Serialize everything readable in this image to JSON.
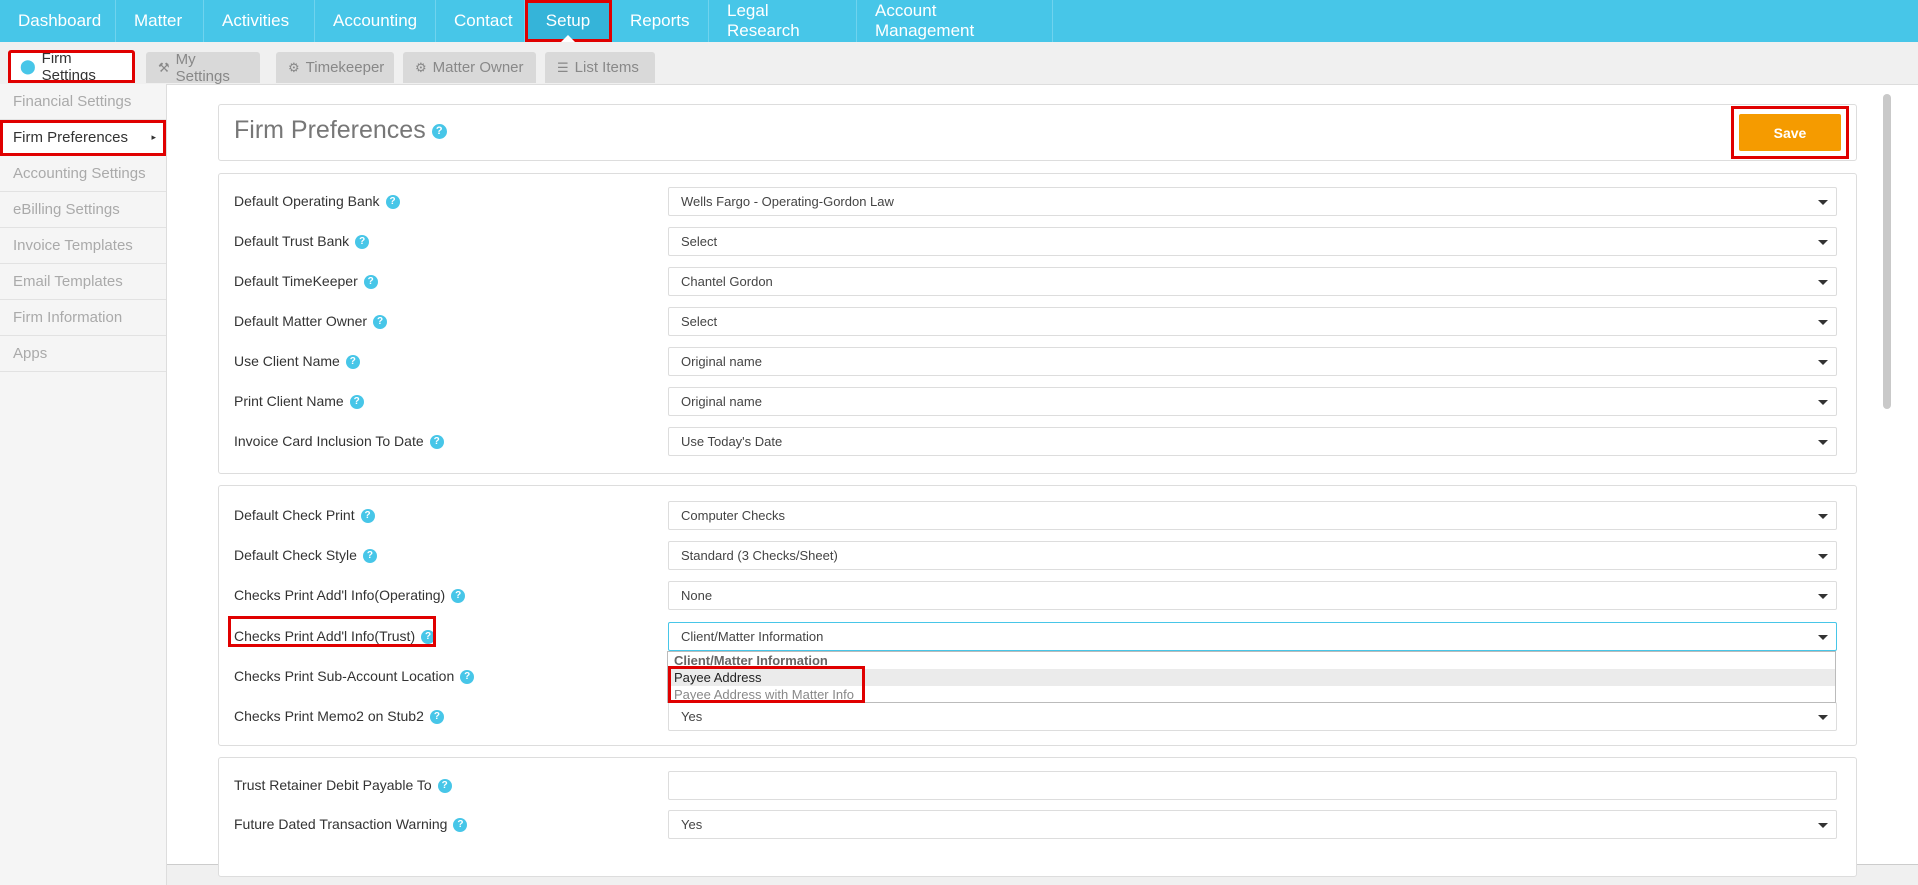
{
  "topnav": {
    "items": [
      {
        "label": "Dashboard"
      },
      {
        "label": "Matter"
      },
      {
        "label": "Activities"
      },
      {
        "label": "Accounting"
      },
      {
        "label": "Contact"
      },
      {
        "label": "Setup",
        "active": true
      },
      {
        "label": "Reports"
      },
      {
        "label": "Legal Research"
      },
      {
        "label": "Account Management"
      }
    ]
  },
  "subtabs": {
    "firm_settings": "Firm Settings",
    "my_settings": "My Settings",
    "timekeeper": "Timekeeper",
    "matter_owner": "Matter Owner",
    "list_items": "List Items"
  },
  "sidebar": {
    "items": [
      {
        "label": "Financial Settings"
      },
      {
        "label": "Firm Preferences",
        "active": true
      },
      {
        "label": "Accounting Settings"
      },
      {
        "label": "eBilling Settings"
      },
      {
        "label": "Invoice Templates"
      },
      {
        "label": "Email Templates"
      },
      {
        "label": "Firm Information"
      },
      {
        "label": "Apps"
      }
    ]
  },
  "panel": {
    "title": "Firm Preferences",
    "save_label": "Save"
  },
  "section1": [
    {
      "label": "Default Operating Bank",
      "value": "Wells Fargo - Operating-Gordon Law"
    },
    {
      "label": "Default Trust Bank",
      "value": "Select"
    },
    {
      "label": "Default TimeKeeper",
      "value": "Chantel Gordon"
    },
    {
      "label": "Default Matter Owner",
      "value": "Select"
    },
    {
      "label": "Use Client Name",
      "value": "Original name"
    },
    {
      "label": "Print Client Name",
      "value": "Original name"
    },
    {
      "label": "Invoice Card Inclusion To Date",
      "value": "Use Today's Date"
    }
  ],
  "section2": [
    {
      "label": "Default Check Print",
      "value": "Computer Checks"
    },
    {
      "label": "Default Check Style",
      "value": "Standard (3 Checks/Sheet)"
    },
    {
      "label": "Checks Print Add'l Info(Operating)",
      "value": "None"
    },
    {
      "label": "Checks Print Add'l Info(Trust)",
      "value": "Client/Matter Information"
    },
    {
      "label": "Checks Print Sub-Account Location",
      "value": ""
    },
    {
      "label": "Checks Print Memo2 on Stub2",
      "value": "Yes"
    }
  ],
  "dropdown": {
    "options": [
      "Client/Matter Information",
      "Payee Address",
      "Payee Address with Matter Info"
    ],
    "highlighted": "Payee Address"
  },
  "section3": [
    {
      "label": "Trust Retainer Debit Payable To",
      "value": ""
    },
    {
      "label": "Future Dated Transaction Warning",
      "value": "Yes"
    }
  ],
  "help_glyph": "?",
  "colors": {
    "nav": "#47c6e8",
    "accent": "#47c6e8",
    "save": "#f59b00",
    "highlight_box": "#e00000"
  }
}
